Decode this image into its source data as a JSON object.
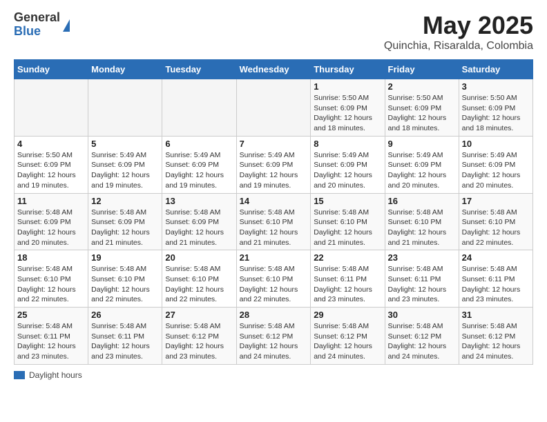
{
  "logo": {
    "general": "General",
    "blue": "Blue"
  },
  "title": "May 2025",
  "subtitle": "Quinchia, Risaralda, Colombia",
  "days_of_week": [
    "Sunday",
    "Monday",
    "Tuesday",
    "Wednesday",
    "Thursday",
    "Friday",
    "Saturday"
  ],
  "legend_label": "Daylight hours",
  "weeks": [
    [
      {
        "num": "",
        "info": ""
      },
      {
        "num": "",
        "info": ""
      },
      {
        "num": "",
        "info": ""
      },
      {
        "num": "",
        "info": ""
      },
      {
        "num": "1",
        "info": "Sunrise: 5:50 AM\nSunset: 6:09 PM\nDaylight: 12 hours and 18 minutes."
      },
      {
        "num": "2",
        "info": "Sunrise: 5:50 AM\nSunset: 6:09 PM\nDaylight: 12 hours and 18 minutes."
      },
      {
        "num": "3",
        "info": "Sunrise: 5:50 AM\nSunset: 6:09 PM\nDaylight: 12 hours and 18 minutes."
      }
    ],
    [
      {
        "num": "4",
        "info": "Sunrise: 5:50 AM\nSunset: 6:09 PM\nDaylight: 12 hours and 19 minutes."
      },
      {
        "num": "5",
        "info": "Sunrise: 5:49 AM\nSunset: 6:09 PM\nDaylight: 12 hours and 19 minutes."
      },
      {
        "num": "6",
        "info": "Sunrise: 5:49 AM\nSunset: 6:09 PM\nDaylight: 12 hours and 19 minutes."
      },
      {
        "num": "7",
        "info": "Sunrise: 5:49 AM\nSunset: 6:09 PM\nDaylight: 12 hours and 19 minutes."
      },
      {
        "num": "8",
        "info": "Sunrise: 5:49 AM\nSunset: 6:09 PM\nDaylight: 12 hours and 20 minutes."
      },
      {
        "num": "9",
        "info": "Sunrise: 5:49 AM\nSunset: 6:09 PM\nDaylight: 12 hours and 20 minutes."
      },
      {
        "num": "10",
        "info": "Sunrise: 5:49 AM\nSunset: 6:09 PM\nDaylight: 12 hours and 20 minutes."
      }
    ],
    [
      {
        "num": "11",
        "info": "Sunrise: 5:48 AM\nSunset: 6:09 PM\nDaylight: 12 hours and 20 minutes."
      },
      {
        "num": "12",
        "info": "Sunrise: 5:48 AM\nSunset: 6:09 PM\nDaylight: 12 hours and 21 minutes."
      },
      {
        "num": "13",
        "info": "Sunrise: 5:48 AM\nSunset: 6:09 PM\nDaylight: 12 hours and 21 minutes."
      },
      {
        "num": "14",
        "info": "Sunrise: 5:48 AM\nSunset: 6:10 PM\nDaylight: 12 hours and 21 minutes."
      },
      {
        "num": "15",
        "info": "Sunrise: 5:48 AM\nSunset: 6:10 PM\nDaylight: 12 hours and 21 minutes."
      },
      {
        "num": "16",
        "info": "Sunrise: 5:48 AM\nSunset: 6:10 PM\nDaylight: 12 hours and 21 minutes."
      },
      {
        "num": "17",
        "info": "Sunrise: 5:48 AM\nSunset: 6:10 PM\nDaylight: 12 hours and 22 minutes."
      }
    ],
    [
      {
        "num": "18",
        "info": "Sunrise: 5:48 AM\nSunset: 6:10 PM\nDaylight: 12 hours and 22 minutes."
      },
      {
        "num": "19",
        "info": "Sunrise: 5:48 AM\nSunset: 6:10 PM\nDaylight: 12 hours and 22 minutes."
      },
      {
        "num": "20",
        "info": "Sunrise: 5:48 AM\nSunset: 6:10 PM\nDaylight: 12 hours and 22 minutes."
      },
      {
        "num": "21",
        "info": "Sunrise: 5:48 AM\nSunset: 6:10 PM\nDaylight: 12 hours and 22 minutes."
      },
      {
        "num": "22",
        "info": "Sunrise: 5:48 AM\nSunset: 6:11 PM\nDaylight: 12 hours and 23 minutes."
      },
      {
        "num": "23",
        "info": "Sunrise: 5:48 AM\nSunset: 6:11 PM\nDaylight: 12 hours and 23 minutes."
      },
      {
        "num": "24",
        "info": "Sunrise: 5:48 AM\nSunset: 6:11 PM\nDaylight: 12 hours and 23 minutes."
      }
    ],
    [
      {
        "num": "25",
        "info": "Sunrise: 5:48 AM\nSunset: 6:11 PM\nDaylight: 12 hours and 23 minutes."
      },
      {
        "num": "26",
        "info": "Sunrise: 5:48 AM\nSunset: 6:11 PM\nDaylight: 12 hours and 23 minutes."
      },
      {
        "num": "27",
        "info": "Sunrise: 5:48 AM\nSunset: 6:12 PM\nDaylight: 12 hours and 23 minutes."
      },
      {
        "num": "28",
        "info": "Sunrise: 5:48 AM\nSunset: 6:12 PM\nDaylight: 12 hours and 24 minutes."
      },
      {
        "num": "29",
        "info": "Sunrise: 5:48 AM\nSunset: 6:12 PM\nDaylight: 12 hours and 24 minutes."
      },
      {
        "num": "30",
        "info": "Sunrise: 5:48 AM\nSunset: 6:12 PM\nDaylight: 12 hours and 24 minutes."
      },
      {
        "num": "31",
        "info": "Sunrise: 5:48 AM\nSunset: 6:12 PM\nDaylight: 12 hours and 24 minutes."
      }
    ]
  ]
}
